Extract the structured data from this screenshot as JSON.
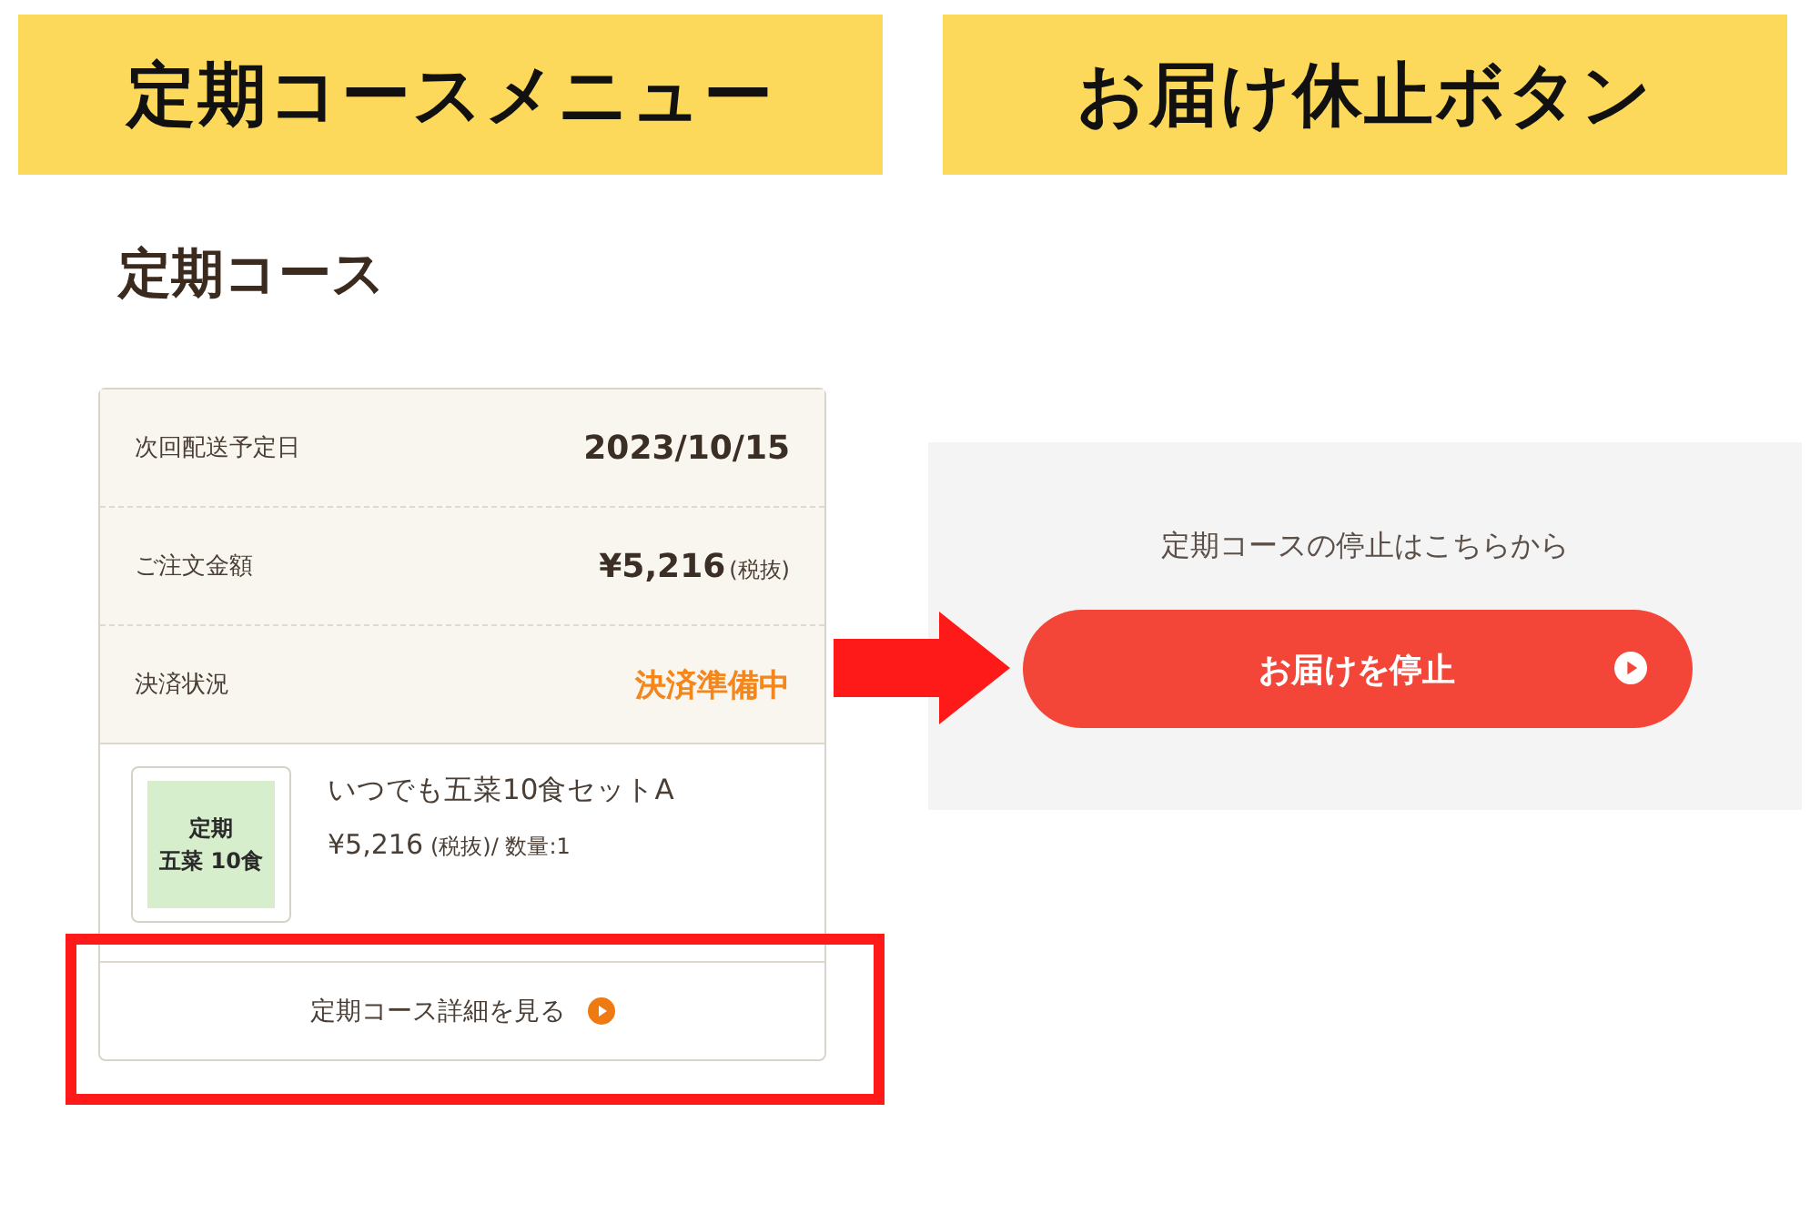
{
  "annotations": {
    "left_label": "定期コースメニュー",
    "right_label": "お届け休止ボタン"
  },
  "section_title": "定期コース",
  "summary_rows": [
    {
      "label": "次回配送予定日",
      "value": "2023/10/15",
      "kind": "plain"
    },
    {
      "label": "ご注文金額",
      "value": "¥5,216",
      "suffix": "(税抜)",
      "kind": "plain"
    },
    {
      "label": "決済状況",
      "value": "決済準備中",
      "kind": "status"
    }
  ],
  "product": {
    "thumb_lines": [
      "定期",
      "五菜 10食"
    ],
    "name": "いつでも五菜10食セットA",
    "price": "¥5,216",
    "price_note": "(税抜)/ 数量:1"
  },
  "detail_link": "定期コース詳細を見る",
  "stop_panel": {
    "caption": "定期コースの停止はこちらから",
    "button": "お届けを停止"
  }
}
